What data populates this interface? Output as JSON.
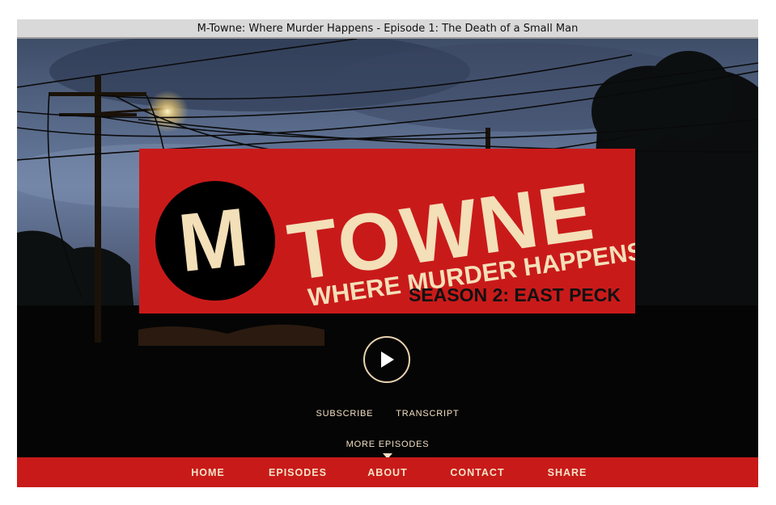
{
  "window": {
    "title": "M-Towne: Where Murder Happens - Episode 1: The Death of a Small Man"
  },
  "logo": {
    "badge_letter": "M",
    "wordmark": "TOWNE",
    "tagline": "WHERE MURDER HAPPENS",
    "season": "SEASON 2: EAST PECK"
  },
  "player": {
    "play_icon": "play-icon"
  },
  "links": {
    "subscribe": "SUBSCRIBE",
    "transcript": "TRANSCRIPT",
    "more_episodes": "MORE EPISODES"
  },
  "nav": {
    "items": [
      {
        "label": "HOME"
      },
      {
        "label": "EPISODES"
      },
      {
        "label": "ABOUT"
      },
      {
        "label": "CONTACT"
      },
      {
        "label": "SHARE"
      }
    ]
  },
  "colors": {
    "brand_red": "#c91a1a",
    "cream": "#f3dfb8",
    "background": "#000000"
  }
}
